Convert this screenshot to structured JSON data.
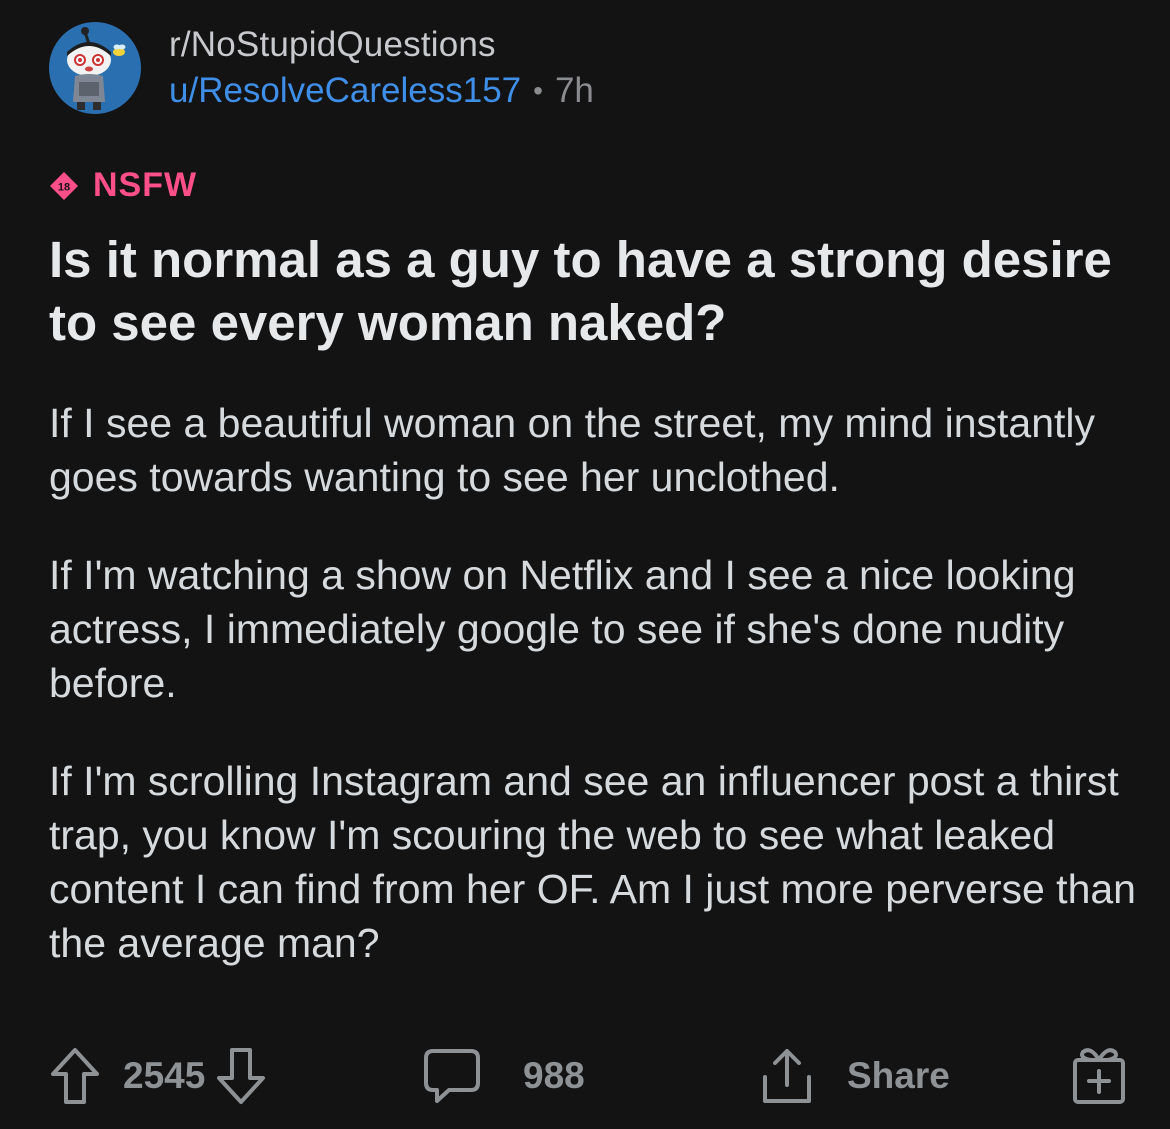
{
  "post": {
    "subreddit": "r/NoStupidQuestions",
    "username": "u/ResolveCareless157",
    "separator": "•",
    "age": "7h",
    "nsfw_badge": "18",
    "nsfw_label": "NSFW",
    "title": "Is it normal as a guy to have a strong desire to see every woman naked?",
    "body": [
      "If I see a beautiful woman on the street, my mind instantly goes towards wanting to see her unclothed.",
      "If I'm watching a show on Netflix and I see a nice looking actress, I immediately google to see if she's done nudity before.",
      "If I'm scrolling Instagram and see an influencer post a thirst trap, you know I'm scouring the web to see what leaked content I can find from her OF. Am I just more perverse than the average man?"
    ]
  },
  "actions": {
    "upvotes": "2545",
    "comments": "988",
    "share_label": "Share"
  },
  "icons": {
    "upvote": "upvote-arrow-icon",
    "downvote": "downvote-arrow-icon",
    "comment": "comment-bubble-icon",
    "share": "share-icon",
    "award": "award-gift-icon"
  },
  "colors": {
    "background": "#131314",
    "username": "#3f8fe8",
    "nsfw": "#ff4f8b",
    "muted": "#8f9295",
    "avatar_bg": "#2a6fb0"
  }
}
